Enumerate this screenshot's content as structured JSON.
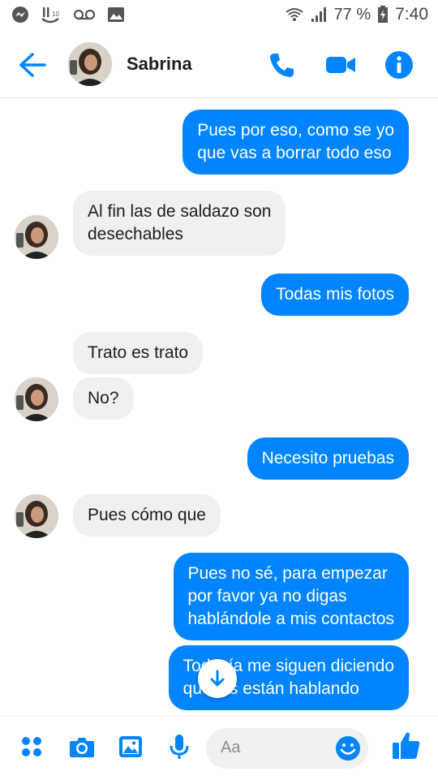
{
  "status_bar": {
    "battery": "77 %",
    "time": "7:40"
  },
  "header": {
    "contact_name": "Sabrina"
  },
  "messages": [
    {
      "side": "out",
      "text": "Pues por eso, como se yo\nque vas a borrar todo eso"
    },
    {
      "side": "in",
      "text": "Al fin las de saldazo son\ndesechables"
    },
    {
      "side": "out",
      "text": "Todas mis fotos"
    },
    {
      "side": "in",
      "text": "Trato es trato"
    },
    {
      "side": "in",
      "text": "No?"
    },
    {
      "side": "out",
      "text": "Necesito pruebas"
    },
    {
      "side": "in",
      "text": "Pues cómo que"
    },
    {
      "side": "out",
      "text": "Pues no sé, para empezar\npor favor ya no digas\nhablándole a mis contactos"
    },
    {
      "side": "out",
      "text": "Todavía me siguen diciendo\nque les están hablando"
    }
  ],
  "composer": {
    "placeholder": "Aa"
  },
  "colors": {
    "accent": "#0084ff",
    "incoming_bubble": "#f1f0f0"
  }
}
